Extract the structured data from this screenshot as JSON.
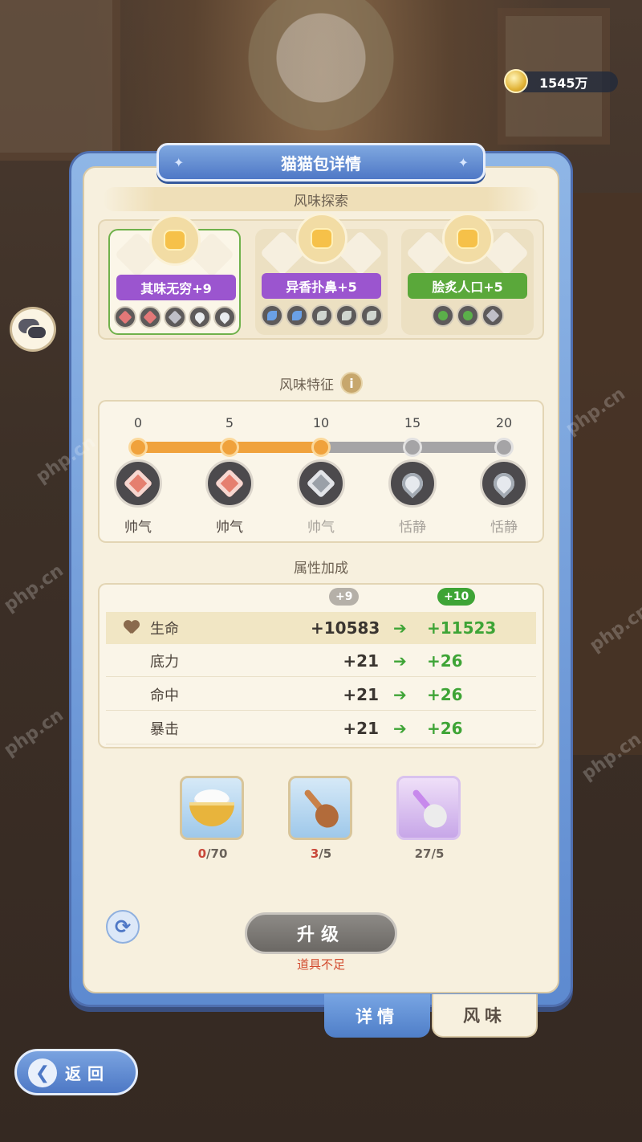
{
  "currency": {
    "amount": "1545万"
  },
  "panel": {
    "title": "猫猫包详情"
  },
  "flavor_explore": {
    "heading": "风味探索",
    "cards": [
      {
        "label": "其味无穷+9",
        "color": "#9b55cf",
        "active": true,
        "icons": [
          "red",
          "red",
          "gray",
          "drop",
          "drop"
        ]
      },
      {
        "label": "异香扑鼻+5",
        "color": "#9b55cf",
        "active": false,
        "icons": [
          "blue",
          "blue",
          "leaf",
          "leaf",
          "leaf"
        ]
      },
      {
        "label": "脍炙人口+5",
        "color": "#5aa83a",
        "active": false,
        "icons": [
          "green",
          "green",
          "gray"
        ]
      }
    ]
  },
  "flavor_traits": {
    "heading": "风味特征",
    "info_icon": "i",
    "ticks": [
      "0",
      "5",
      "10",
      "15",
      "20"
    ],
    "progress_fraction": 0.5,
    "traits": [
      {
        "label": "帅气",
        "type": "red",
        "dim": false
      },
      {
        "label": "帅气",
        "type": "red",
        "dim": false
      },
      {
        "label": "帅气",
        "type": "gray",
        "dim": true
      },
      {
        "label": "恬静",
        "type": "drop",
        "dim": true
      },
      {
        "label": "恬静",
        "type": "drop",
        "dim": true
      }
    ]
  },
  "attributes": {
    "heading": "属性加成",
    "current_level": "+9",
    "next_level": "+10",
    "arrow": "➔",
    "rows": [
      {
        "name": "生命",
        "from": "+10583",
        "to": "+11523",
        "highlight": true
      },
      {
        "name": "底力",
        "from": "+21",
        "to": "+26",
        "highlight": false
      },
      {
        "name": "命中",
        "from": "+21",
        "to": "+26",
        "highlight": false
      },
      {
        "name": "暴击",
        "from": "+21",
        "to": "+26",
        "highlight": false
      }
    ]
  },
  "items": [
    {
      "icon": "rice-bowl-icon",
      "have": "0",
      "need": "/70"
    },
    {
      "icon": "wooden-spoon-icon",
      "have": "3",
      "need": "/5"
    },
    {
      "icon": "silver-spoon-icon",
      "have": "27",
      "need": "/5"
    }
  ],
  "actions": {
    "upgrade_label": "升级",
    "warning": "道具不足",
    "refresh_icon": "⟳"
  },
  "tabs": {
    "details": "详情",
    "flavor": "风味"
  },
  "back": {
    "label": "返回",
    "arrow": "❮"
  },
  "watermark": "php.cn"
}
